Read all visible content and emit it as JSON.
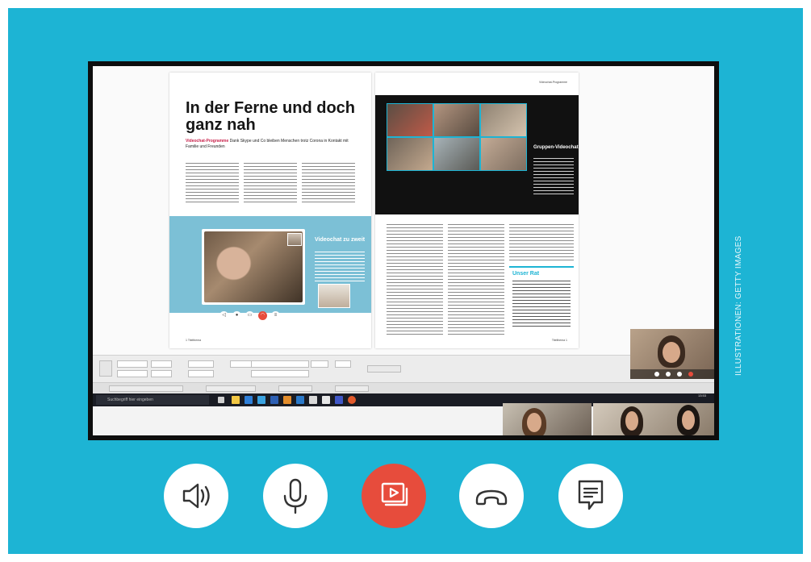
{
  "credit": "ILLUSTRATIONEN: GETTY IMAGES",
  "magazine": {
    "headline": "In der Ferne und doch ganz nah",
    "deck_kicker": "Videochat-Programme",
    "deck_text": "Dank Skype und Co bleiben Menschen trotz Corona in Kontakt mit Familie und Freunden",
    "left_box_title": "Videochat zu zweit",
    "right_panel_title": "Gruppen-Videochat",
    "right_box_title": "Unser Rat",
    "folio_left": "1  Titelthema",
    "folio_right": "Titelthema  1",
    "page_tag": "Videochat-Programme"
  },
  "taskbar": {
    "search_placeholder": "Suchbegriff hier eingeben",
    "time": "13:53"
  },
  "call_controls": [
    {
      "name": "speaker",
      "icon": "speaker-icon"
    },
    {
      "name": "microphone",
      "icon": "microphone-icon"
    },
    {
      "name": "share-screen",
      "icon": "present-screen-icon",
      "active": true,
      "color": "#e74c3c"
    },
    {
      "name": "hang-up",
      "icon": "phone-hangup-icon"
    },
    {
      "name": "chat",
      "icon": "chat-icon"
    }
  ],
  "colors": {
    "background": "#1db4d4",
    "accent_red": "#e74c3c",
    "magenta": "#c8204a"
  }
}
